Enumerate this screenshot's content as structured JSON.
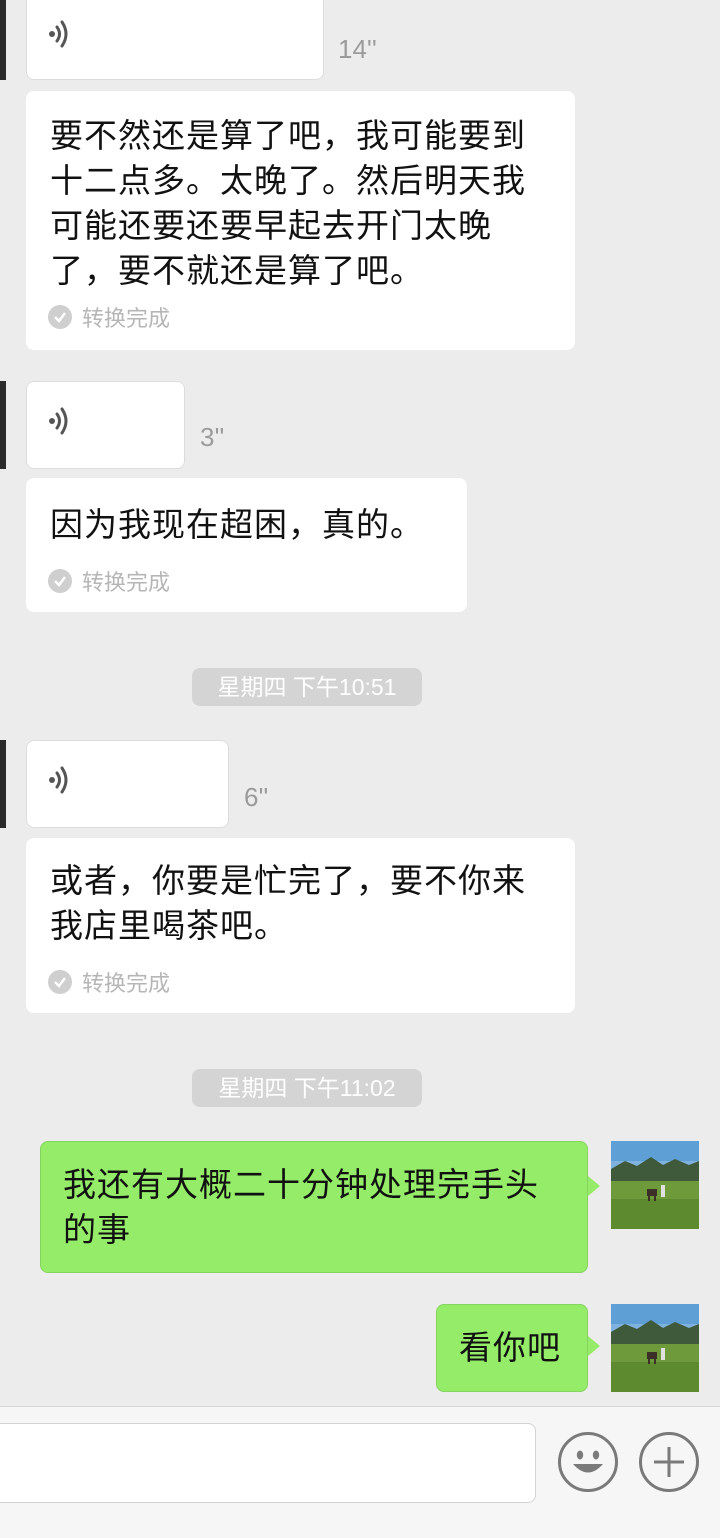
{
  "messages": [
    {
      "type": "voice",
      "duration": "14''"
    },
    {
      "type": "transcript",
      "text": "要不然还是算了吧，我可能要到十二点多。太晚了。然后明天我可能还要还要早起去开门太晚了，要不就还是算了吧。",
      "status": "转换完成"
    },
    {
      "type": "voice",
      "duration": "3''"
    },
    {
      "type": "transcript",
      "text": "因为我现在超困，真的。",
      "status": "转换完成"
    },
    {
      "type": "time",
      "text": "星期四 下午10:51"
    },
    {
      "type": "voice",
      "duration": "6''"
    },
    {
      "type": "transcript",
      "text": "或者，你要是忙完了，要不你来我店里喝茶吧。",
      "status": "转换完成"
    },
    {
      "type": "time",
      "text": "星期四 下午11:02"
    },
    {
      "type": "sent",
      "text": "我还有大概二十分钟处理完手头的事"
    },
    {
      "type": "sent",
      "text": "看你吧"
    }
  ],
  "input": {
    "placeholder": ""
  },
  "icons": {
    "emoji": "emoji-icon",
    "plus": "plus-icon",
    "voice": "voice-wave-icon",
    "check": "check-icon"
  },
  "colors": {
    "background": "#ececec",
    "sent_bubble": "#95ec69",
    "received_bubble": "#ffffff",
    "timestamp_bg": "#d4d4d4"
  }
}
